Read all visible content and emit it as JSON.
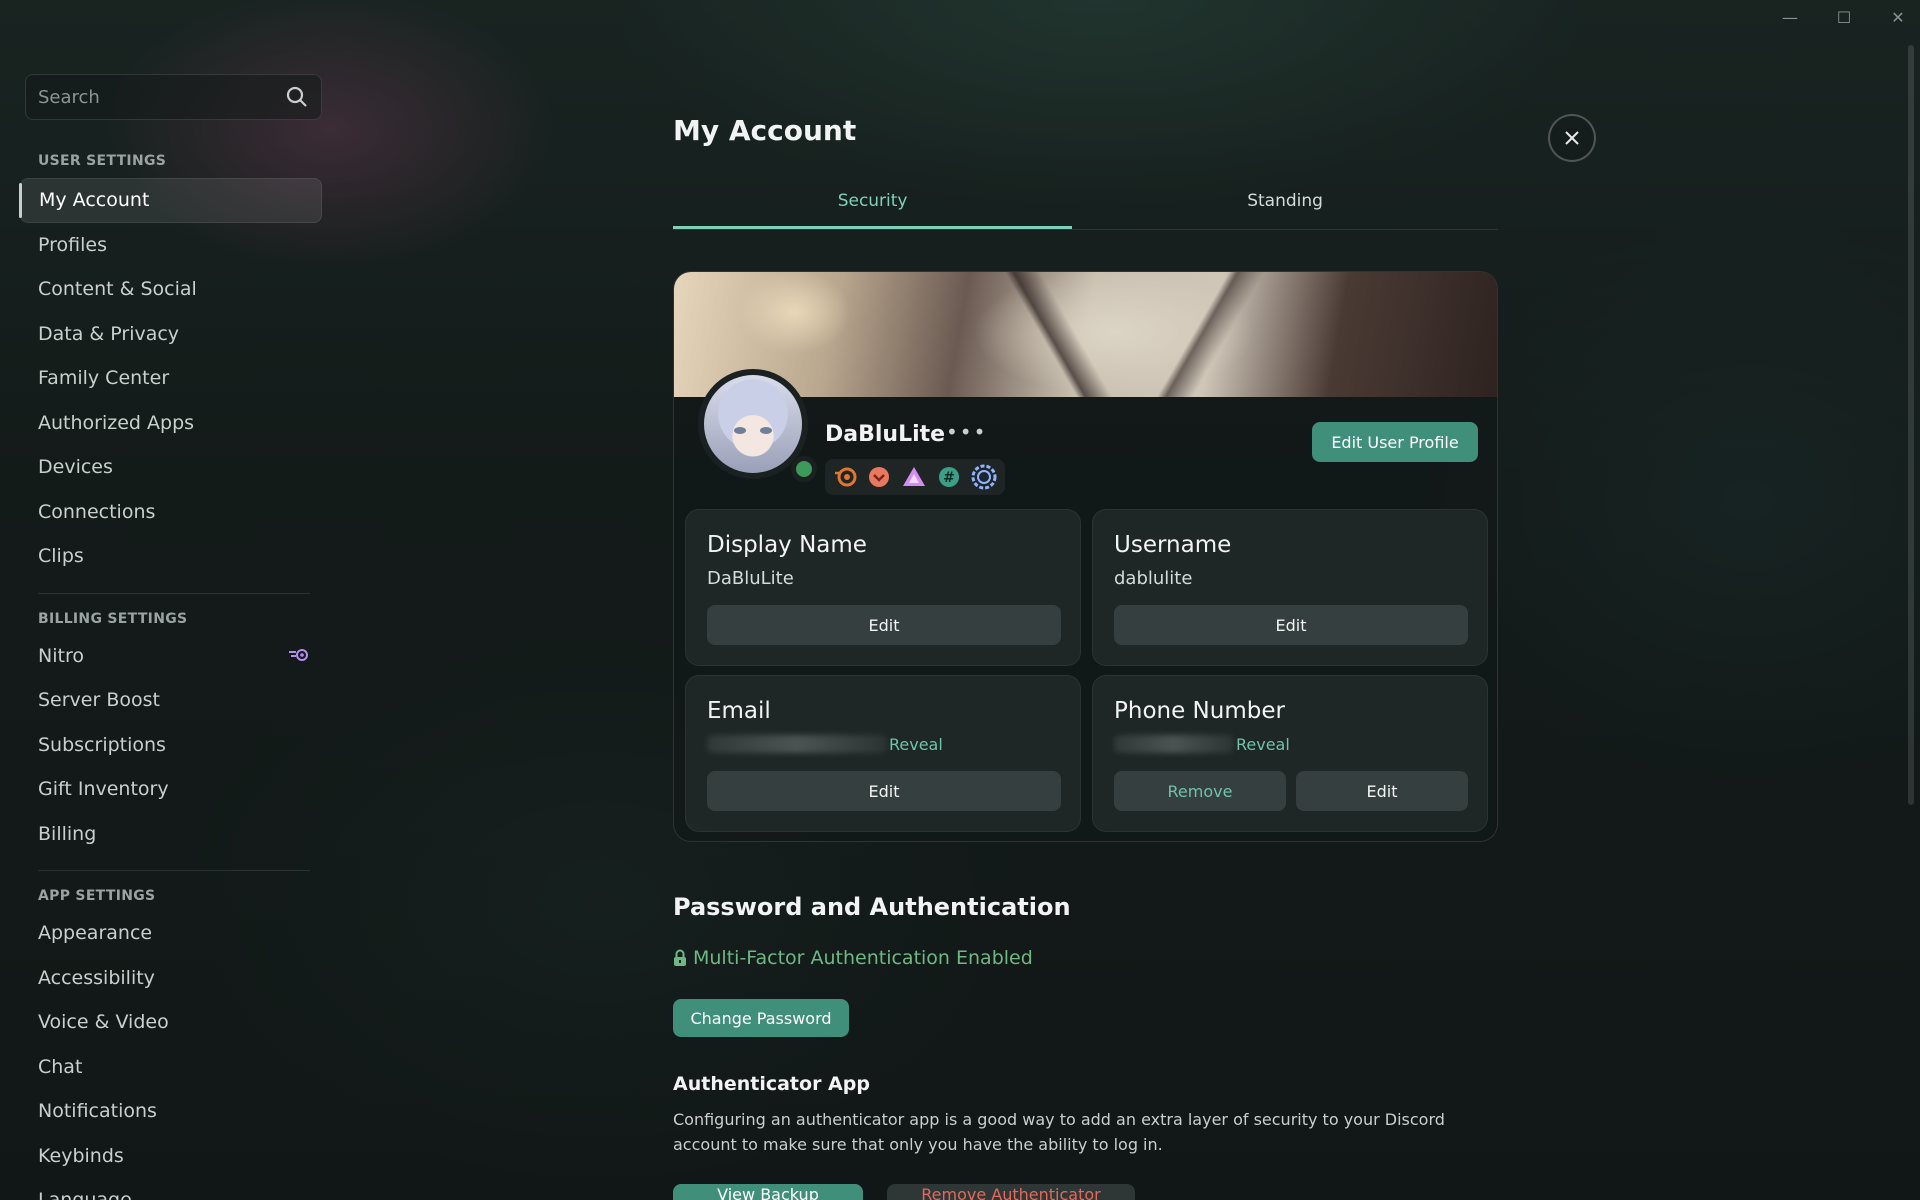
{
  "window": {
    "minimize": "—",
    "maximize": "☐",
    "close": "✕"
  },
  "search": {
    "placeholder": "Search"
  },
  "sidebar": {
    "user_settings_title": "USER SETTINGS",
    "user_items": [
      "My Account",
      "Profiles",
      "Content & Social",
      "Data & Privacy",
      "Family Center",
      "Authorized Apps",
      "Devices",
      "Connections",
      "Clips"
    ],
    "billing_title": "BILLING SETTINGS",
    "billing_items": [
      "Nitro",
      "Server Boost",
      "Subscriptions",
      "Gift Inventory",
      "Billing"
    ],
    "app_title": "APP SETTINGS",
    "app_items": [
      "Appearance",
      "Accessibility",
      "Voice & Video",
      "Chat",
      "Notifications",
      "Keybinds",
      "Language"
    ]
  },
  "main": {
    "title": "My Account",
    "tabs": [
      "Security",
      "Standing"
    ],
    "profile": {
      "display_name": "DaBluLite",
      "more": "•••",
      "edit_profile_label": "Edit User Profile",
      "status": "online"
    },
    "fields": {
      "display_name": {
        "label": "Display Name",
        "value": "DaBluLite",
        "edit": "Edit"
      },
      "username": {
        "label": "Username",
        "value": "dablulite",
        "edit": "Edit"
      },
      "email": {
        "label": "Email",
        "reveal": "Reveal",
        "edit": "Edit"
      },
      "phone": {
        "label": "Phone Number",
        "reveal": "Reveal",
        "remove": "Remove",
        "edit": "Edit"
      }
    },
    "password_section": {
      "title": "Password and Authentication",
      "mfa_status": "Multi-Factor Authentication Enabled",
      "change_password": "Change Password",
      "authenticator_title": "Authenticator App",
      "authenticator_desc": "Configuring an authenticator app is a good way to add an extra layer of security to your Discord account to make sure that only you have the ability to log in.",
      "view_backup_codes": "View Backup Codes",
      "remove_authenticator": "Remove Authenticator App"
    }
  },
  "colors": {
    "accent": "#3f8f7a",
    "accent_text": "#7fd0bb",
    "mfa_green": "#6fb883",
    "danger": "#e06a5c"
  }
}
